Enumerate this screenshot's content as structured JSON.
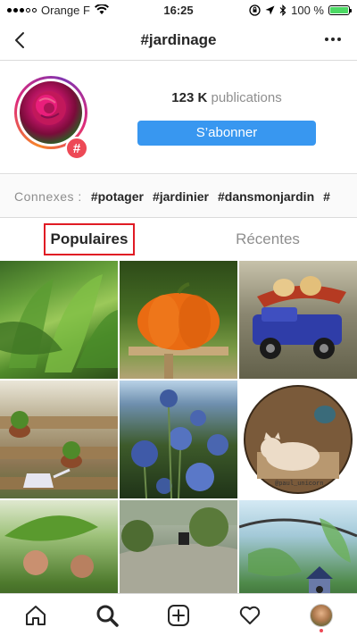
{
  "status_bar": {
    "carrier": "Orange F",
    "time": "16:25",
    "battery": "100 %",
    "battery_level": 1.0
  },
  "header": {
    "title": "#jardinage"
  },
  "profile": {
    "count": "123 K",
    "count_label": "publications",
    "subscribe_label": "S’abonner",
    "badge": "#"
  },
  "related": {
    "label": "Connexes :",
    "tags": [
      "#potager",
      "#jardinier",
      "#dansmonjardin",
      "#"
    ]
  },
  "tabs": {
    "popular": "Populaires",
    "recent": "Récentes"
  },
  "grid": {
    "tiles": [
      {
        "subject": "chard-leaves"
      },
      {
        "subject": "pumpkin"
      },
      {
        "subject": "toy-pickup-truck"
      },
      {
        "subject": "pallet-garden"
      },
      {
        "subject": "globe-thistle-flowers"
      },
      {
        "subject": "cat-circle-photo"
      },
      {
        "subject": "couple-with-leaf"
      },
      {
        "subject": "garden-yard"
      },
      {
        "subject": "birdhouse-branch"
      }
    ],
    "tile6_caption": "@paul_unicorn"
  },
  "tab_bar": {
    "items": [
      "home-icon",
      "search-icon",
      "add-post-icon",
      "heart-icon",
      "profile-avatar"
    ]
  },
  "colors": {
    "accent_blue": "#3897f0",
    "badge_red": "#ed4956",
    "highlight_red": "#e01b24",
    "battery_green": "#4cd964"
  }
}
